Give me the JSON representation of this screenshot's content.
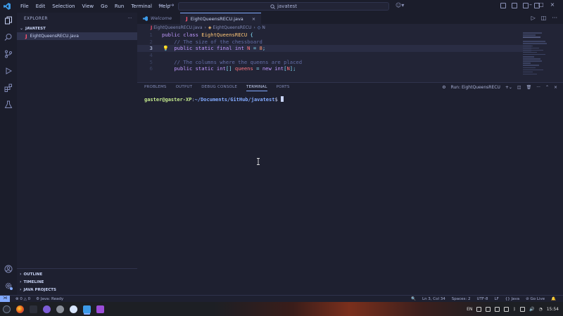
{
  "titlebar": {
    "menu": [
      "File",
      "Edit",
      "Selection",
      "View",
      "Go",
      "Run",
      "Terminal",
      "Help"
    ],
    "search_text": "javatest"
  },
  "sidebar": {
    "title": "EXPLORER",
    "more": "···",
    "folder": "JAVATEST",
    "files": [
      {
        "name": "EightQueensRECU.java",
        "icon": "J"
      }
    ],
    "sections": [
      "OUTLINE",
      "TIMELINE",
      "JAVA PROJECTS"
    ]
  },
  "editor": {
    "tabs": [
      {
        "label": "Welcome",
        "active": false,
        "icon": "vscode-icon"
      },
      {
        "label": "EightQueensRECU.java",
        "active": true,
        "icon": "J",
        "close": "×"
      }
    ],
    "breadcrumb": [
      "EightQueensRECU.java",
      "EightQueensRECU",
      "N"
    ],
    "lines": [
      {
        "n": "1",
        "text": "public class EightQueensRECU {"
      },
      {
        "n": "2",
        "text": "    // The size of the chessboard"
      },
      {
        "n": "3",
        "text": "    public static final int N = 8;"
      },
      {
        "n": "4",
        "text": ""
      },
      {
        "n": "5",
        "text": "    // The columns where the queens are placed"
      },
      {
        "n": "6",
        "text": "    public static int[] queens = new int[N];"
      }
    ],
    "current_line": 3
  },
  "panel": {
    "tabs": [
      "PROBLEMS",
      "OUTPUT",
      "DEBUG CONSOLE",
      "TERMINAL",
      "PORTS"
    ],
    "active_tab": "TERMINAL",
    "run_label": "Run: EightQueensRECU",
    "terminal": {
      "user": "gaster@gaster-XP",
      "sep": ":",
      "path": "~/Documents/GitHub/javatest",
      "prompt": "$"
    }
  },
  "statusbar": {
    "errors": "0",
    "warnings": "0",
    "java_status": "Java: Ready",
    "position": "Ln 3, Col 34",
    "spaces": "Spaces: 2",
    "encoding": "UTF-8",
    "eol": "LF",
    "language": "Java",
    "golive": "Go Live"
  },
  "taskbar": {
    "lang": "EN",
    "time": "15:54"
  },
  "colors": {
    "accent": "#82aaff",
    "background": "#222436",
    "keyword": "#c099ff",
    "class": "#ffc777",
    "comment": "#636da6"
  }
}
